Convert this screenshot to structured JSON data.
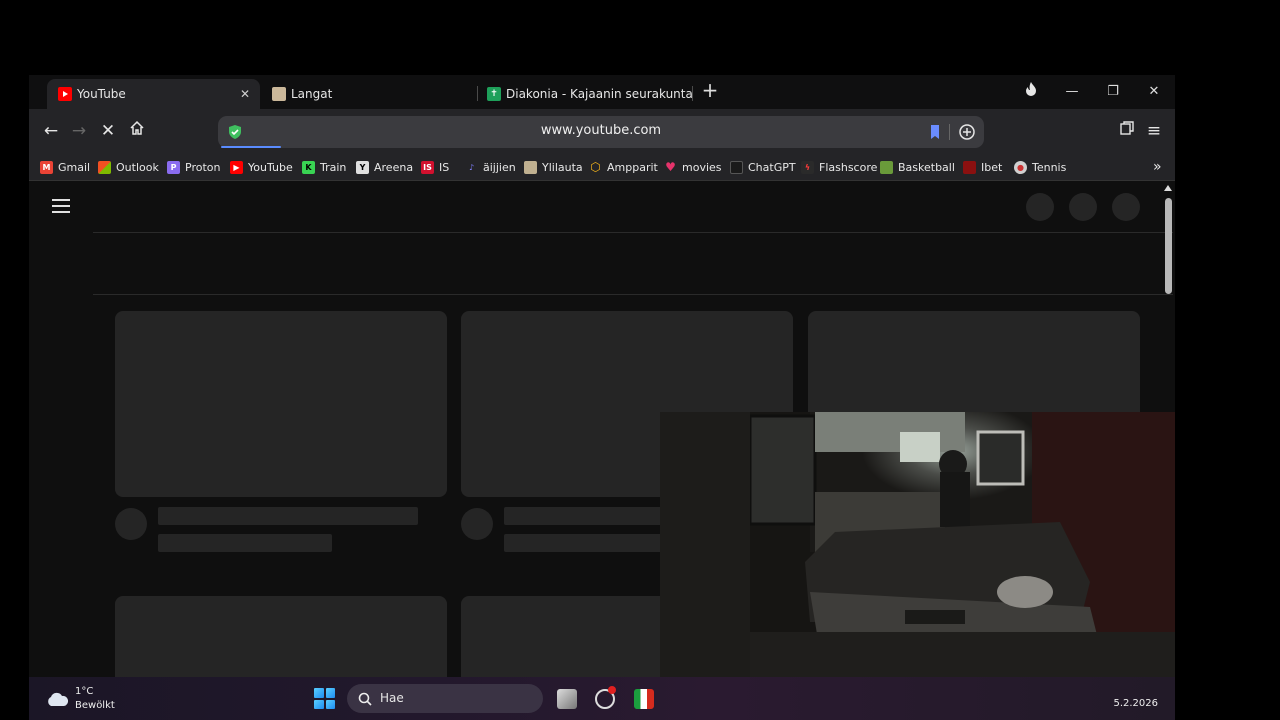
{
  "browser": {
    "tabs": [
      {
        "label": "YouTube",
        "active": true
      },
      {
        "label": "Langat",
        "active": false
      },
      {
        "label": "Diakonia - Kajaanin seurakunta",
        "active": false
      }
    ],
    "url": "www.youtube.com"
  },
  "bookmarks": [
    {
      "label": "Gmail",
      "icon": "gmail-icon",
      "color": "#ea4335"
    },
    {
      "label": "Outlook",
      "icon": "microsoft-icon",
      "color": "#f25022"
    },
    {
      "label": "Proton",
      "icon": "proton-icon",
      "color": "#8a6cf0"
    },
    {
      "label": "YouTube",
      "icon": "youtube-icon",
      "color": "#ff0000"
    },
    {
      "label": "Train",
      "icon": "train-icon",
      "color": "#39d353"
    },
    {
      "label": "Areena",
      "icon": "areena-icon",
      "color": "#e0e0e0"
    },
    {
      "label": "IS",
      "icon": "is-icon",
      "color": "#d1102e"
    },
    {
      "label": "äijjien",
      "icon": "aijjien-icon",
      "color": "#6060c0"
    },
    {
      "label": "Ylilauta",
      "icon": "ylilauta-icon",
      "color": "#c0b090"
    },
    {
      "label": "Ampparit",
      "icon": "ampparit-icon",
      "color": "#f2b21b"
    },
    {
      "label": "movies",
      "icon": "heart-icon",
      "color": "#e5336b"
    },
    {
      "label": "ChatGPT",
      "icon": "chatgpt-icon",
      "color": "#1a1a1a"
    },
    {
      "label": "Flashscore",
      "icon": "flashscore-icon",
      "color": "#2a2a2a"
    },
    {
      "label": "Basketball",
      "icon": "basketball-icon",
      "color": "#6a9a3a"
    },
    {
      "label": "Ibet",
      "icon": "ibet-icon",
      "color": "#8a1010"
    },
    {
      "label": "Tennis",
      "icon": "tennis-icon",
      "color": "#d0d0d0"
    }
  ],
  "taskbar": {
    "temperature": "1°C",
    "condition": "Bewölkt",
    "search_placeholder": "Hae",
    "date": "5.2.2026"
  }
}
